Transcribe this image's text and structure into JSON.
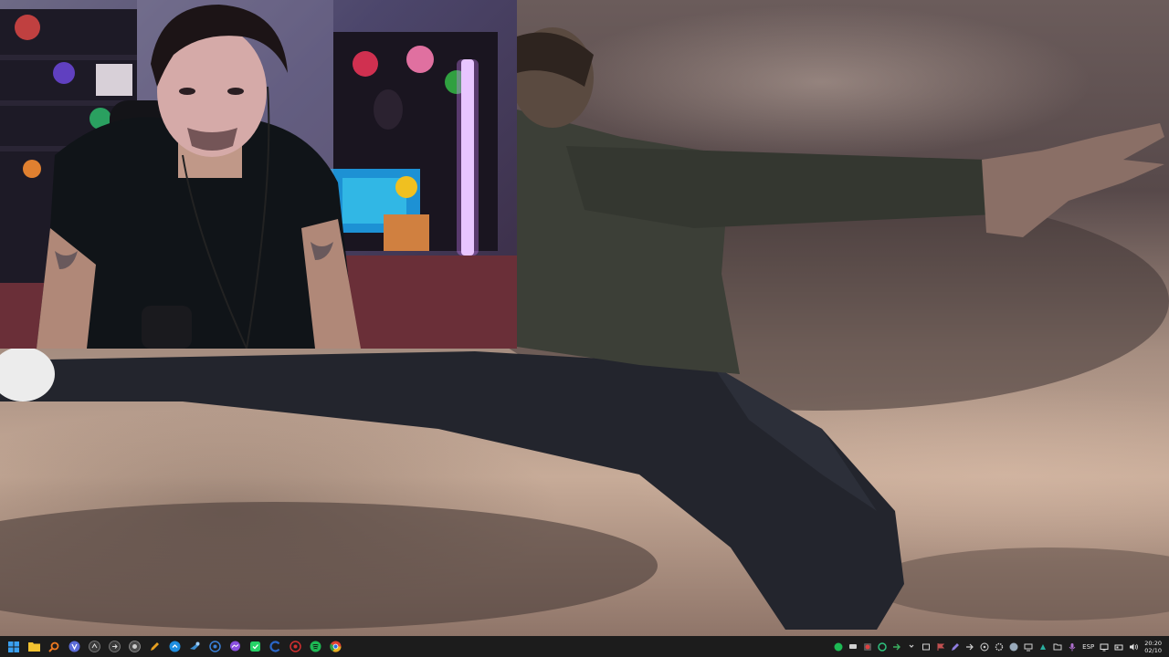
{
  "taskbar": {
    "left_icons": [
      {
        "name": "windows-start-icon",
        "color": "#3aa0f0"
      },
      {
        "name": "file-explorer-icon",
        "color": "#f2c230"
      },
      {
        "name": "search-icon",
        "color": "#f07a20"
      },
      {
        "name": "vpn-app-icon",
        "color": "#5b6bd8"
      },
      {
        "name": "app-icon-ae",
        "color": "#3a3a3a"
      },
      {
        "name": "app-icon-arrow",
        "color": "#3a3a3a"
      },
      {
        "name": "app-icon-obs",
        "color": "#4a4a4a"
      },
      {
        "name": "pen-app-icon",
        "color": "#e8a020"
      },
      {
        "name": "cloud-app-icon",
        "color": "#1f8ee0"
      },
      {
        "name": "steam-icon",
        "color": "#2a475e"
      },
      {
        "name": "network-app-icon",
        "color": "#3a7fd6"
      },
      {
        "name": "messenger-icon",
        "color": "#8a4fe0"
      },
      {
        "name": "whatsapp-icon",
        "color": "#25d366"
      },
      {
        "name": "ccleaner-icon",
        "color": "#2a66c8"
      },
      {
        "name": "spider-app-icon",
        "color": "#d03030"
      },
      {
        "name": "spotify-icon",
        "color": "#1db954"
      },
      {
        "name": "chrome-icon",
        "color": "#e8b020"
      }
    ],
    "tray_icons": [
      {
        "name": "tray-green-icon",
        "color": "#1db954"
      },
      {
        "name": "tray-chat-icon",
        "color": "#d0d0d0"
      },
      {
        "name": "tray-record-icon",
        "color": "#e04040"
      },
      {
        "name": "tray-circle-icon",
        "color": "#2ec27e"
      },
      {
        "name": "tray-arrow-icon",
        "color": "#3ab060"
      },
      {
        "name": "tray-chevron-icon",
        "color": "#d0d0d0"
      },
      {
        "name": "tray-box-icon",
        "color": "#d0d0d0"
      },
      {
        "name": "tray-flag-icon",
        "color": "#c05050"
      },
      {
        "name": "tray-pen-icon",
        "color": "#8f7de0"
      },
      {
        "name": "tray-forward-icon",
        "color": "#d0d0d0"
      },
      {
        "name": "tray-dots-icon",
        "color": "#d0d0d0"
      },
      {
        "name": "tray-gear-icon",
        "color": "#d0d0d0"
      },
      {
        "name": "tray-steam-icon",
        "color": "#9ab"
      },
      {
        "name": "tray-display-icon",
        "color": "#d0d0d0"
      },
      {
        "name": "tray-teal-icon",
        "color": "#2ab0a0"
      },
      {
        "name": "tray-folder-icon",
        "color": "#d0d0d0"
      },
      {
        "name": "tray-mic-icon",
        "color": "#b070d0"
      }
    ],
    "language": "ESP",
    "system_icons": [
      {
        "name": "monitor-icon"
      },
      {
        "name": "wifi-icon"
      },
      {
        "name": "volume-icon"
      }
    ],
    "clock": {
      "time": "20:20",
      "date": "02/10"
    }
  }
}
